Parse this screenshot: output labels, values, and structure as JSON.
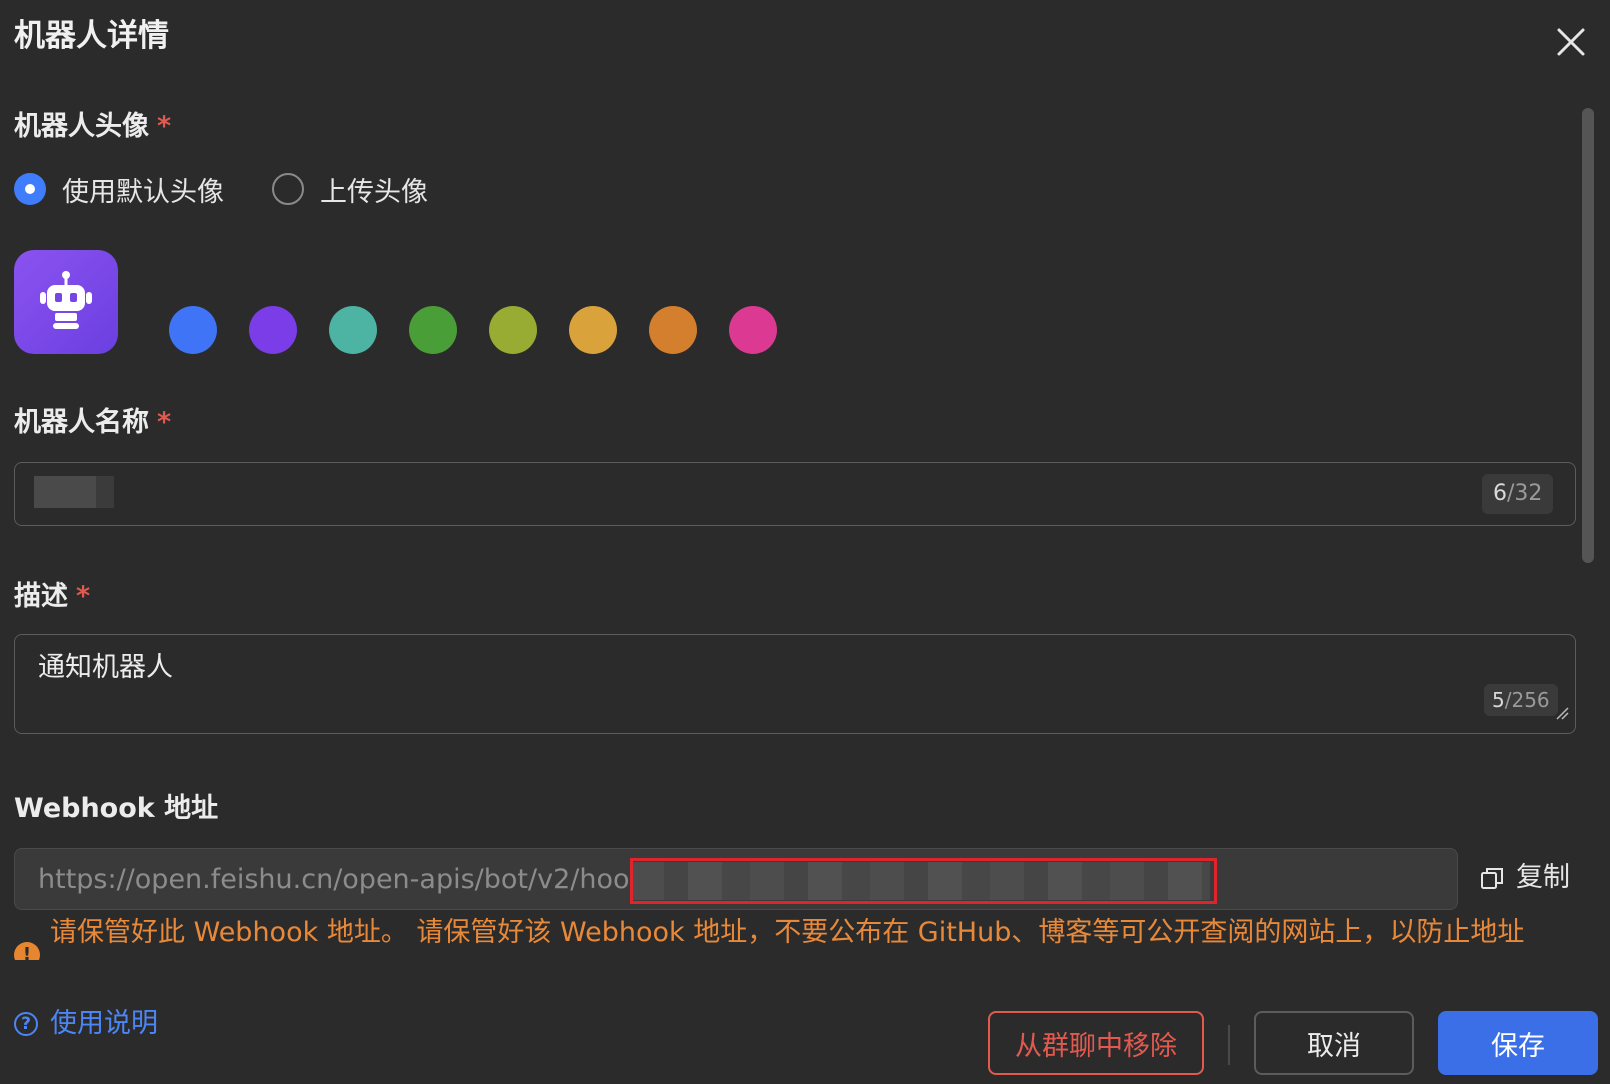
{
  "dialog": {
    "title": "机器人详情"
  },
  "avatar_section": {
    "label": "机器人头像",
    "required_mark": "*",
    "options": [
      {
        "label": "使用默认头像",
        "selected": true
      },
      {
        "label": "上传头像",
        "selected": false
      }
    ],
    "avatar_icon": "robot-icon",
    "swatches": [
      "#3e74f5",
      "#7b3de8",
      "#4db3a3",
      "#4a9e38",
      "#98ab32",
      "#d9a23a",
      "#d47f2e",
      "#dc3a92"
    ]
  },
  "name_section": {
    "label": "机器人名称",
    "required_mark": "*",
    "counter_current": "6",
    "counter_max": "/32"
  },
  "description_section": {
    "label": "描述",
    "required_mark": "*",
    "value": "通知机器人",
    "counter_current": "5",
    "counter_max": "/256"
  },
  "webhook_section": {
    "label": "Webhook 地址",
    "url_prefix": "https://open.feishu.cn/open-apis/bot/v2/hook/",
    "copy_label": "复制",
    "copy_icon": "copy-icon",
    "warning_icon": "warning-icon",
    "warning": "请保管好此 Webhook 地址。 请保管好该 Webhook 地址，不要公布在 GitHub、博客等可公开查阅的网站上，以防止地址"
  },
  "footer": {
    "help_label": "使用说明",
    "help_icon": "question-circle-icon",
    "remove_label": "从群聊中移除",
    "cancel_label": "取消",
    "save_label": "保存"
  },
  "colors": {
    "background": "#2b2b2b",
    "primary": "#3a6fe8",
    "danger": "#e25a4f",
    "warning": "#e8893a",
    "link": "#4c86f5"
  }
}
